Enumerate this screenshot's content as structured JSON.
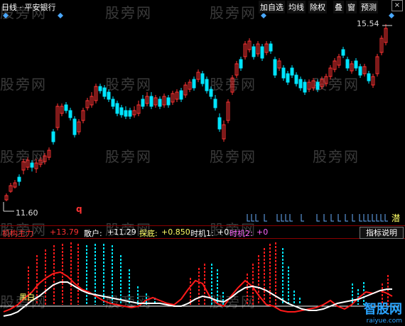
{
  "header": {
    "title": "日线 · 平安银行",
    "buttons": [
      "加自选",
      "均线",
      "除权",
      "叠",
      "窗",
      "预测"
    ],
    "close_label": "×"
  },
  "price_panel": {
    "high_label": "15.54",
    "low_label": "11.60",
    "marker_q": "q",
    "marker_qian": "潜"
  },
  "indicator": {
    "name_label": "机构主力",
    "name_value": "+13.79",
    "sanhu_label": "散户:",
    "sanhu_value": "+11.29",
    "tandi_label": "探底:",
    "tandi_value": "+0.850",
    "shiji1_label": "时机1:",
    "shiji1_value": "+0",
    "shiji2_label": "时机2:",
    "shiji2_value": "+0",
    "help_label": "指标说明",
    "heibai_label": "黑白"
  },
  "watermark": {
    "text": "股旁网",
    "site_big": "智股网",
    "site_small": "raiyue.com"
  },
  "colors": {
    "up": "#ff3333",
    "down": "#00e5ff",
    "white_line": "#ffffff",
    "red_line": "#ff1a1a",
    "diamond": "#4aa8ff",
    "yellow": "#ffff66",
    "magenta": "#ff66ff"
  }
}
